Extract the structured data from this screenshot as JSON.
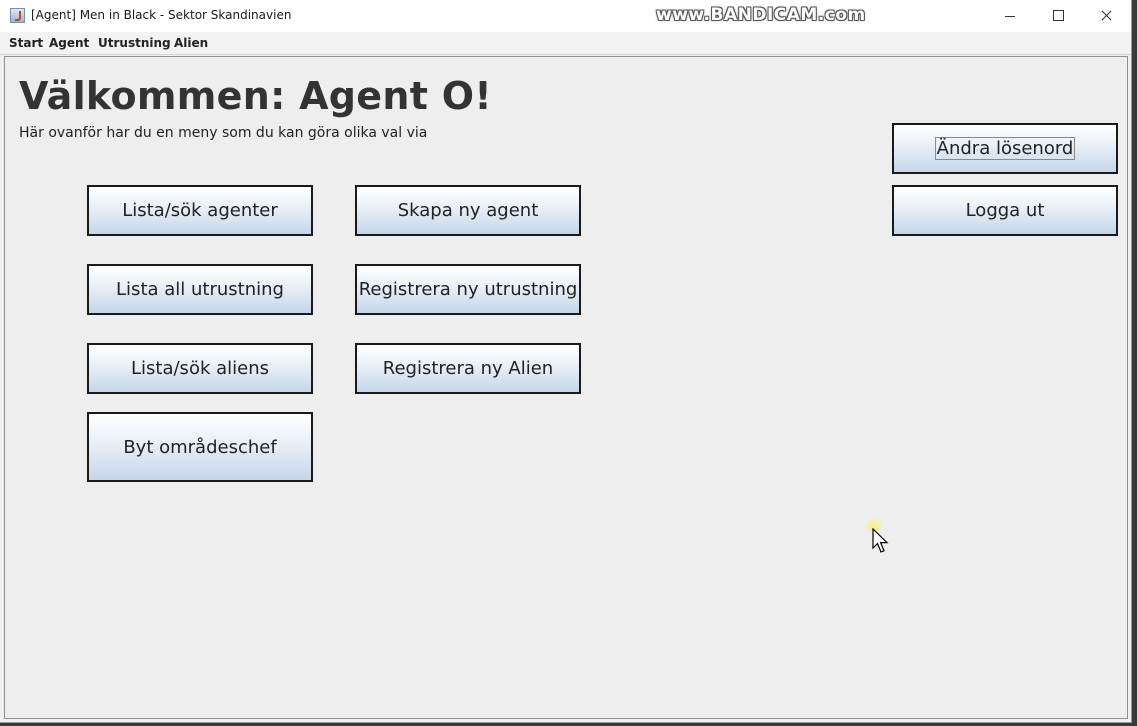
{
  "window": {
    "title": "[Agent] Men in Black - Sektor Skandinavien",
    "icon": "java-cup-icon"
  },
  "watermark": "www.BANDICAM.com",
  "menu": [
    {
      "label": "Start"
    },
    {
      "label": "Agent"
    },
    {
      "label": "Utrustning"
    },
    {
      "label": "Alien"
    }
  ],
  "main": {
    "heading": "Välkommen: Agent O!",
    "subtitle": "Här ovanför har du en meny som du kan göra olika val via"
  },
  "buttons": {
    "list_agents": "Lista/sök agenter",
    "create_agent": "Skapa ny agent",
    "list_equipment": "Lista all utrustning",
    "register_equipment": "Registrera ny utrustning",
    "list_aliens": "Lista/sök aliens",
    "register_alien": "Registrera ny Alien",
    "change_area_chief": "Byt områdeschef",
    "change_password": "Ändra lösenord",
    "logout": "Logga ut"
  },
  "colors": {
    "button_gradient_top": "#ffffff",
    "button_gradient_bottom": "#c5d6e9",
    "panel_background": "#eeeeee"
  }
}
